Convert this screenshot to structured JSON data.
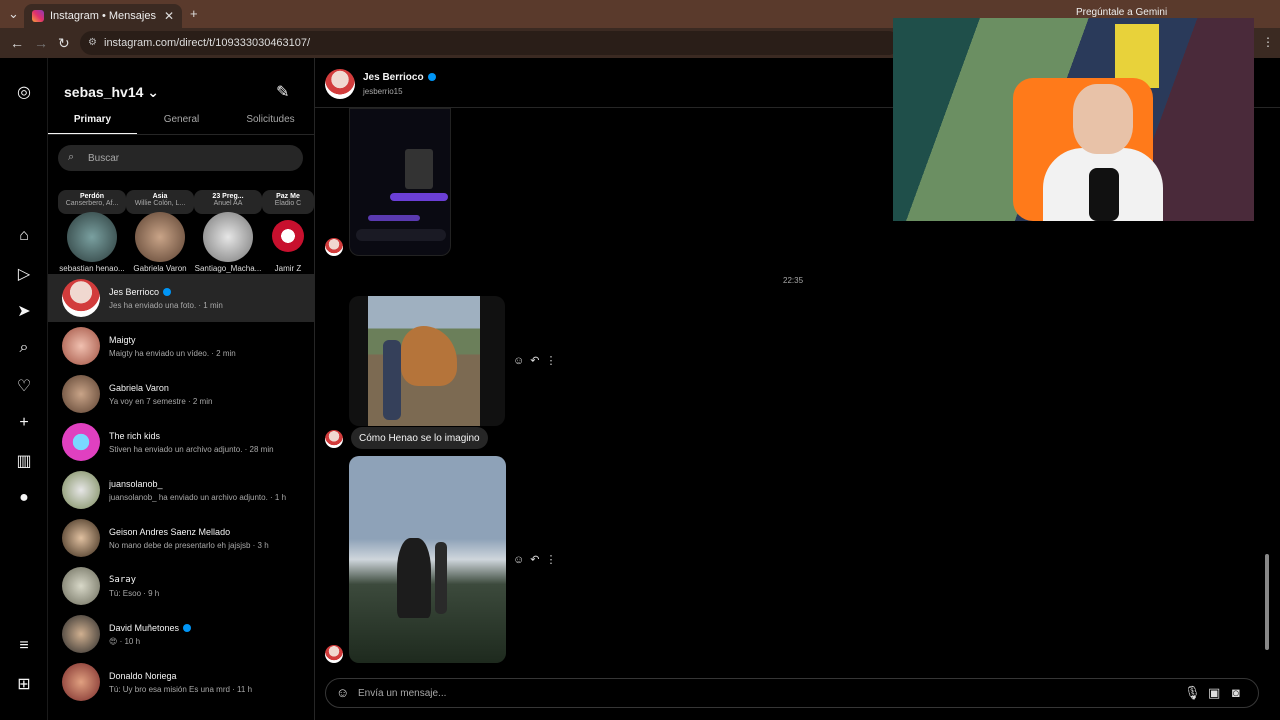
{
  "browser": {
    "tab_title": "Instagram • Mensajes",
    "url": "instagram.com/direct/t/109333030463107/",
    "gemini_label": "Pregúntale a Gemini"
  },
  "rail": {
    "icons": [
      "instagram-logo-icon",
      "home-icon",
      "reels-icon",
      "direct-icon",
      "search-icon",
      "heart-icon",
      "create-icon",
      "dashboard-icon",
      "profile-icon",
      "menu-icon",
      "more-icon"
    ]
  },
  "panel": {
    "username": "sebas_hv14",
    "tabs": [
      "Primary",
      "General",
      "Solicitudes"
    ],
    "search_placeholder": "Buscar",
    "notes": [
      {
        "title": "Perdón",
        "subtitle": "Canserbero, Af...",
        "name": "sebastian henao..."
      },
      {
        "title": "Asia",
        "subtitle": "Willie Colón, L...",
        "name": "Gabriela Varon"
      },
      {
        "title": "23 Preg...",
        "subtitle": "Anuel AA",
        "name": "Santiago_Macha..."
      },
      {
        "title": "Paz Me",
        "subtitle": "Eladio C",
        "name": "Jamir Z"
      }
    ],
    "conversations": [
      {
        "name": "Jes Berrioco",
        "preview": "Jes ha enviado una foto. · 1 min",
        "verified": true,
        "selected": true
      },
      {
        "name": "Maigty",
        "preview": "Maigty ha enviado un vídeo. · 2 min"
      },
      {
        "name": "Gabriela Varon",
        "preview": "Ya voy en 7 semestre · 2 min"
      },
      {
        "name": "The rich kids",
        "preview": "Stiven ha enviado un archivo adjunto. · 28 min"
      },
      {
        "name": "juansolanob_",
        "preview": "juansolanob_ ha enviado un archivo adjunto. · 1 h"
      },
      {
        "name": "Geison Andres Saenz Mellado",
        "preview": "No mano debe de presentarlo eh jajsjsb · 3 h"
      },
      {
        "name": "Saray",
        "preview": "Tú: Esoo · 9 h"
      },
      {
        "name": "David Muñetones",
        "preview": "😍 · 10 h",
        "verified": true
      },
      {
        "name": "Donaldo Noriega",
        "preview": "Tú: Uy bro esa misión Es una mrd · 11 h"
      }
    ]
  },
  "chat": {
    "name": "Jes Berrioco",
    "handle": "jesberrio15",
    "time_separator": "22:35",
    "caption": "Cómo Henao se lo imagino",
    "composer_placeholder": "Envía un mensaje..."
  },
  "colors": {
    "accent": "#0095f6",
    "bg": "#000000",
    "bubble": "#262626"
  }
}
